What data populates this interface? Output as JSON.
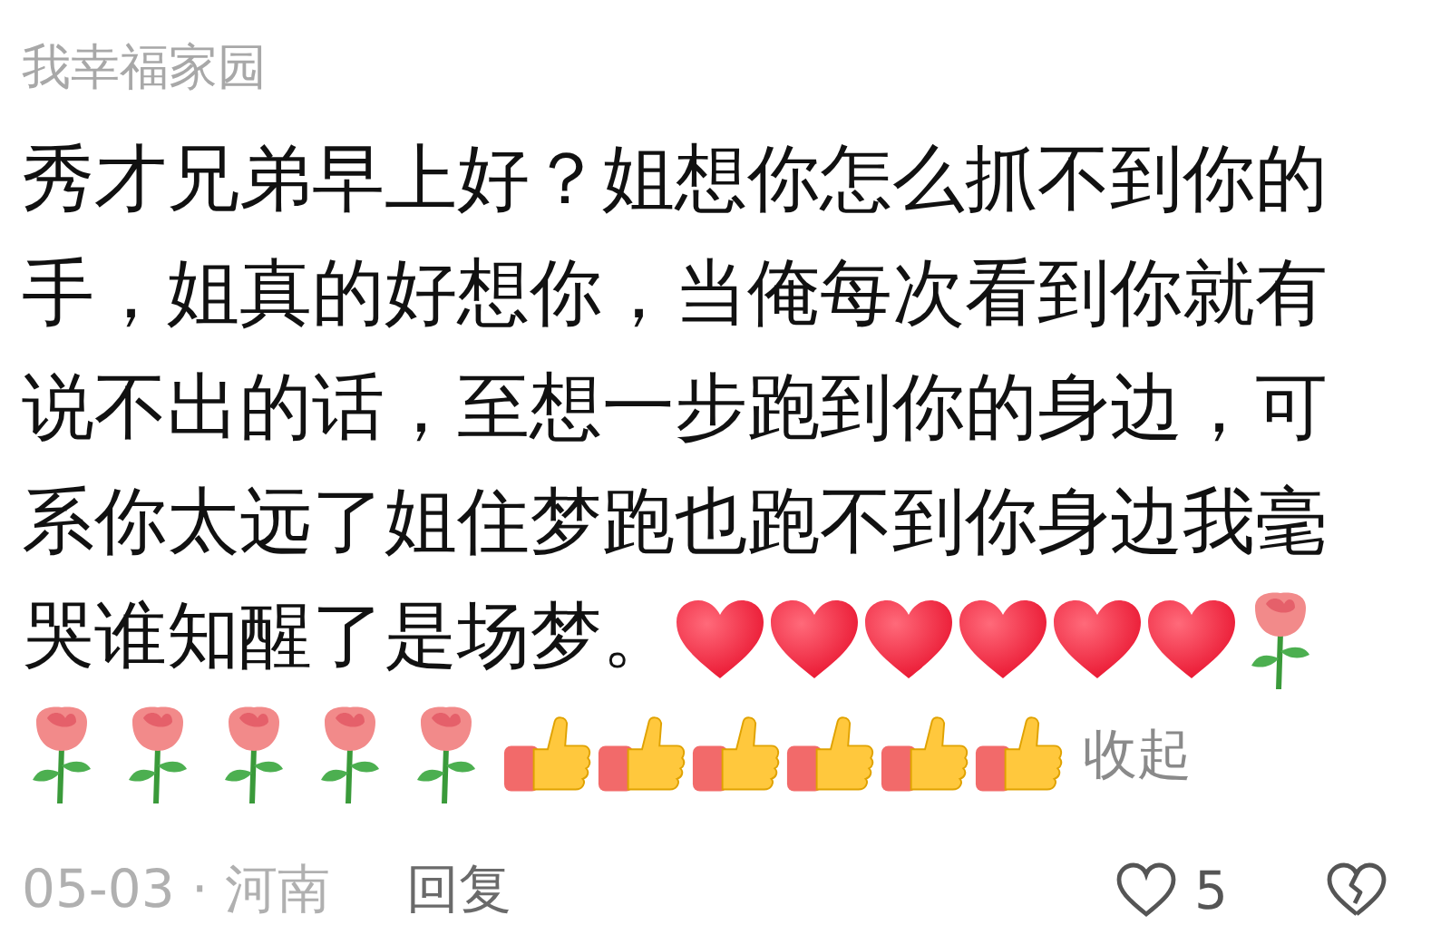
{
  "author": "我幸福家园",
  "comment": {
    "lines": [
      "秀才兄弟早上好？姐想你怎么抓不到你的",
      "手，姐真的好想你，当俺每次看到你就有",
      "说不出的话，至想一步跑到你的身边，可",
      "系你太远了姐住梦跑也跑不到你身边我毫",
      "哭谁知醒了是场梦。"
    ],
    "emojis": [
      {
        "kind": "heart"
      },
      {
        "kind": "heart"
      },
      {
        "kind": "heart"
      },
      {
        "kind": "heart"
      },
      {
        "kind": "heart"
      },
      {
        "kind": "heart"
      },
      {
        "kind": "rose"
      },
      {
        "kind": "rose"
      },
      {
        "kind": "rose"
      },
      {
        "kind": "rose"
      },
      {
        "kind": "rose"
      },
      {
        "kind": "rose"
      },
      {
        "kind": "thumbs_up"
      },
      {
        "kind": "thumbs_up"
      },
      {
        "kind": "thumbs_up"
      },
      {
        "kind": "thumbs_up"
      },
      {
        "kind": "thumbs_up"
      },
      {
        "kind": "thumbs_up"
      }
    ],
    "collapse_link": "收起"
  },
  "footer": {
    "meta": "05-03 · 河南",
    "reply": "回复",
    "likes": "5"
  }
}
